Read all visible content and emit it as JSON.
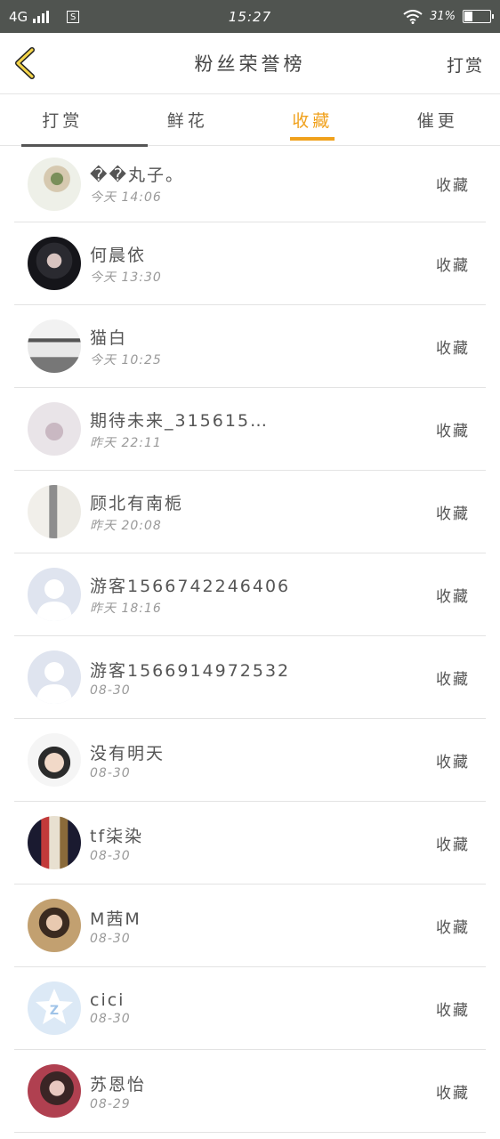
{
  "status_bar": {
    "network": "4G",
    "sim_icon": "S",
    "time": "15:27",
    "battery_text": "31%",
    "battery_level": 0.31,
    "wifi_icon": "wifi-icon"
  },
  "header": {
    "back_icon": "chevron-left-icon",
    "title": "粉丝荣誉榜",
    "action": "打赏",
    "accent": "#f0a11c"
  },
  "tabs": [
    {
      "label": "打赏",
      "active": false
    },
    {
      "label": "鲜花",
      "active": false
    },
    {
      "label": "收藏",
      "active": true
    },
    {
      "label": "催更",
      "active": false
    }
  ],
  "items": [
    {
      "name": "��丸子。",
      "time": "今天 14:06",
      "action": "收藏",
      "avatar": "flower-photo"
    },
    {
      "name": "何晨依",
      "time": "今天 13:30",
      "action": "收藏",
      "avatar": "dark-portrait"
    },
    {
      "name": "猫白",
      "time": "今天 10:25",
      "action": "收藏",
      "avatar": "umbrella-scene"
    },
    {
      "name": "期待未来_315615…",
      "time": "昨天 22:11",
      "action": "收藏",
      "avatar": "couple-photo"
    },
    {
      "name": "顾北有南栀",
      "time": "昨天 20:08",
      "action": "收藏",
      "avatar": "standing-figure"
    },
    {
      "name": "游客1566742246406",
      "time": "昨天 18:16",
      "action": "收藏",
      "avatar": "default-user"
    },
    {
      "name": "游客1566914972532",
      "time": "08-30",
      "action": "收藏",
      "avatar": "default-user"
    },
    {
      "name": "没有明天",
      "time": "08-30",
      "action": "收藏",
      "avatar": "boy-portrait"
    },
    {
      "name": "tf柒染",
      "time": "08-30",
      "action": "收藏",
      "avatar": "group-photo"
    },
    {
      "name": "M茜M",
      "time": "08-30",
      "action": "收藏",
      "avatar": "girl-portrait"
    },
    {
      "name": "cici",
      "time": "08-30",
      "action": "收藏",
      "avatar": "qq-default"
    },
    {
      "name": "苏恩怡",
      "time": "08-29",
      "action": "收藏",
      "avatar": "girl-selfie"
    }
  ]
}
